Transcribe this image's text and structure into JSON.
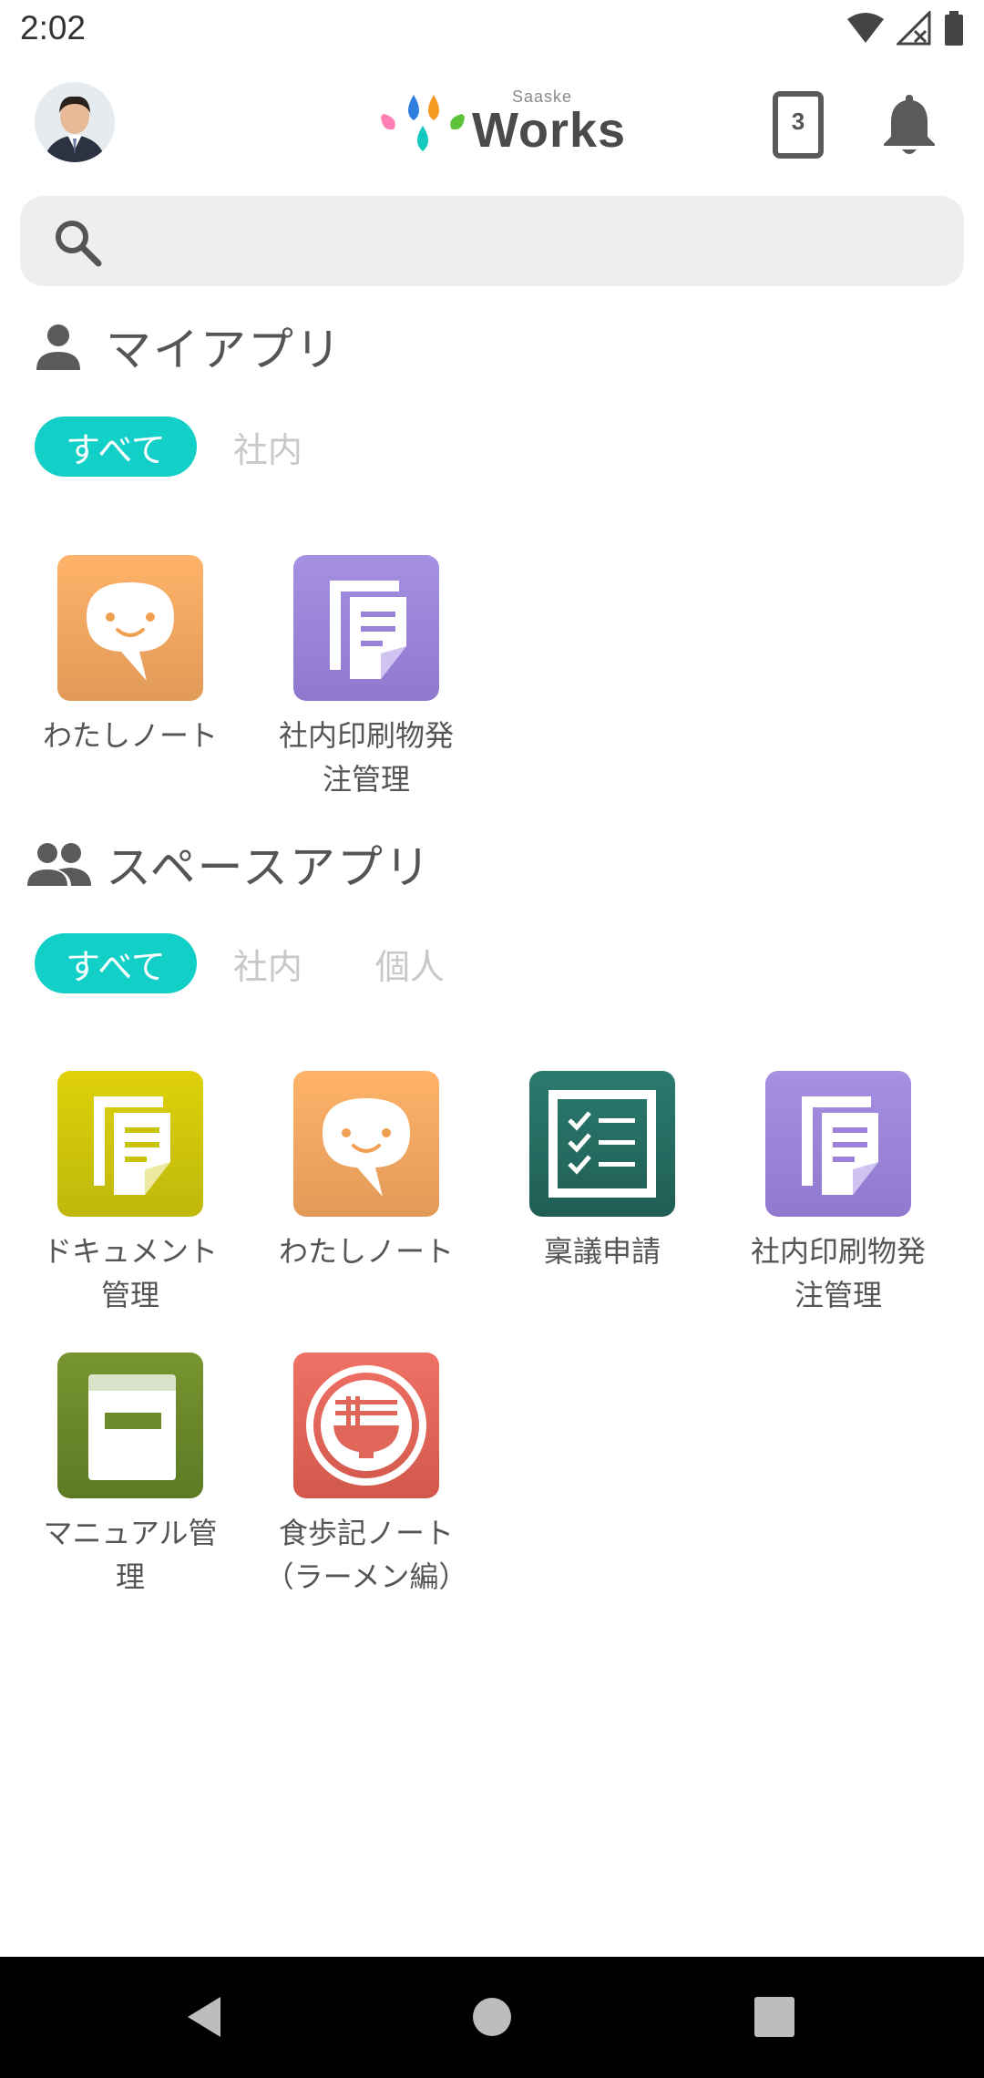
{
  "status_bar": {
    "time": "2:02"
  },
  "header": {
    "logo_sub": "Saaske",
    "logo_main": "Works",
    "tablet_badge": "3"
  },
  "search": {
    "placeholder": ""
  },
  "my_apps": {
    "title": "マイアプリ",
    "tabs": [
      {
        "label": "すべて",
        "active": true
      },
      {
        "label": "社内",
        "active": false
      }
    ],
    "apps": [
      {
        "label": "わたしノート",
        "icon": "chat-smile-icon"
      },
      {
        "label": "社内印刷物発\n注管理",
        "icon": "document-icon"
      }
    ]
  },
  "space_apps": {
    "title": "スペースアプリ",
    "tabs": [
      {
        "label": "すべて",
        "active": true
      },
      {
        "label": "社内",
        "active": false
      },
      {
        "label": "個人",
        "active": false
      }
    ],
    "apps": [
      {
        "label": "ドキュメント\n管理",
        "icon": "document-icon"
      },
      {
        "label": "わたしノート",
        "icon": "chat-smile-icon"
      },
      {
        "label": "稟議申請",
        "icon": "checklist-icon"
      },
      {
        "label": "社内印刷物発\n注管理",
        "icon": "document-icon"
      },
      {
        "label": "マニュアル管\n理",
        "icon": "book-icon"
      },
      {
        "label": "食歩記ノート\n（ラーメン編）",
        "icon": "ramen-bowl-icon"
      }
    ]
  },
  "colors": {
    "accent": "#12cfc7",
    "orange": "#f4a259",
    "purple": "#9a82d8",
    "yellow": "#c9c40b",
    "teal": "#2a6e64",
    "olive": "#6d8a2c",
    "red": "#e0665a"
  }
}
